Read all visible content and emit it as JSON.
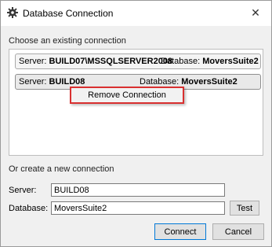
{
  "window": {
    "title": "Database Connection",
    "icon": "gear-icon",
    "close_glyph": "✕"
  },
  "existing": {
    "heading": "Choose an existing connection",
    "connections": [
      {
        "server_label": "Server:",
        "server": "BUILD07\\MSSQLSERVER2008",
        "database_label": "Database:",
        "database": "MoversSuite2"
      },
      {
        "server_label": "Server:",
        "server": "BUILD08",
        "database_label": "Database:",
        "database": "MoversSuite2"
      }
    ]
  },
  "context_menu": {
    "items": [
      "Remove Connection"
    ],
    "highlight_color": "#d93030"
  },
  "create": {
    "heading": "Or create a new connection",
    "server_label": "Server:",
    "server_value": "BUILD08",
    "database_label": "Database:",
    "database_value": "MoversSuite2",
    "test_label": "Test"
  },
  "footer": {
    "connect_label": "Connect",
    "cancel_label": "Cancel"
  }
}
